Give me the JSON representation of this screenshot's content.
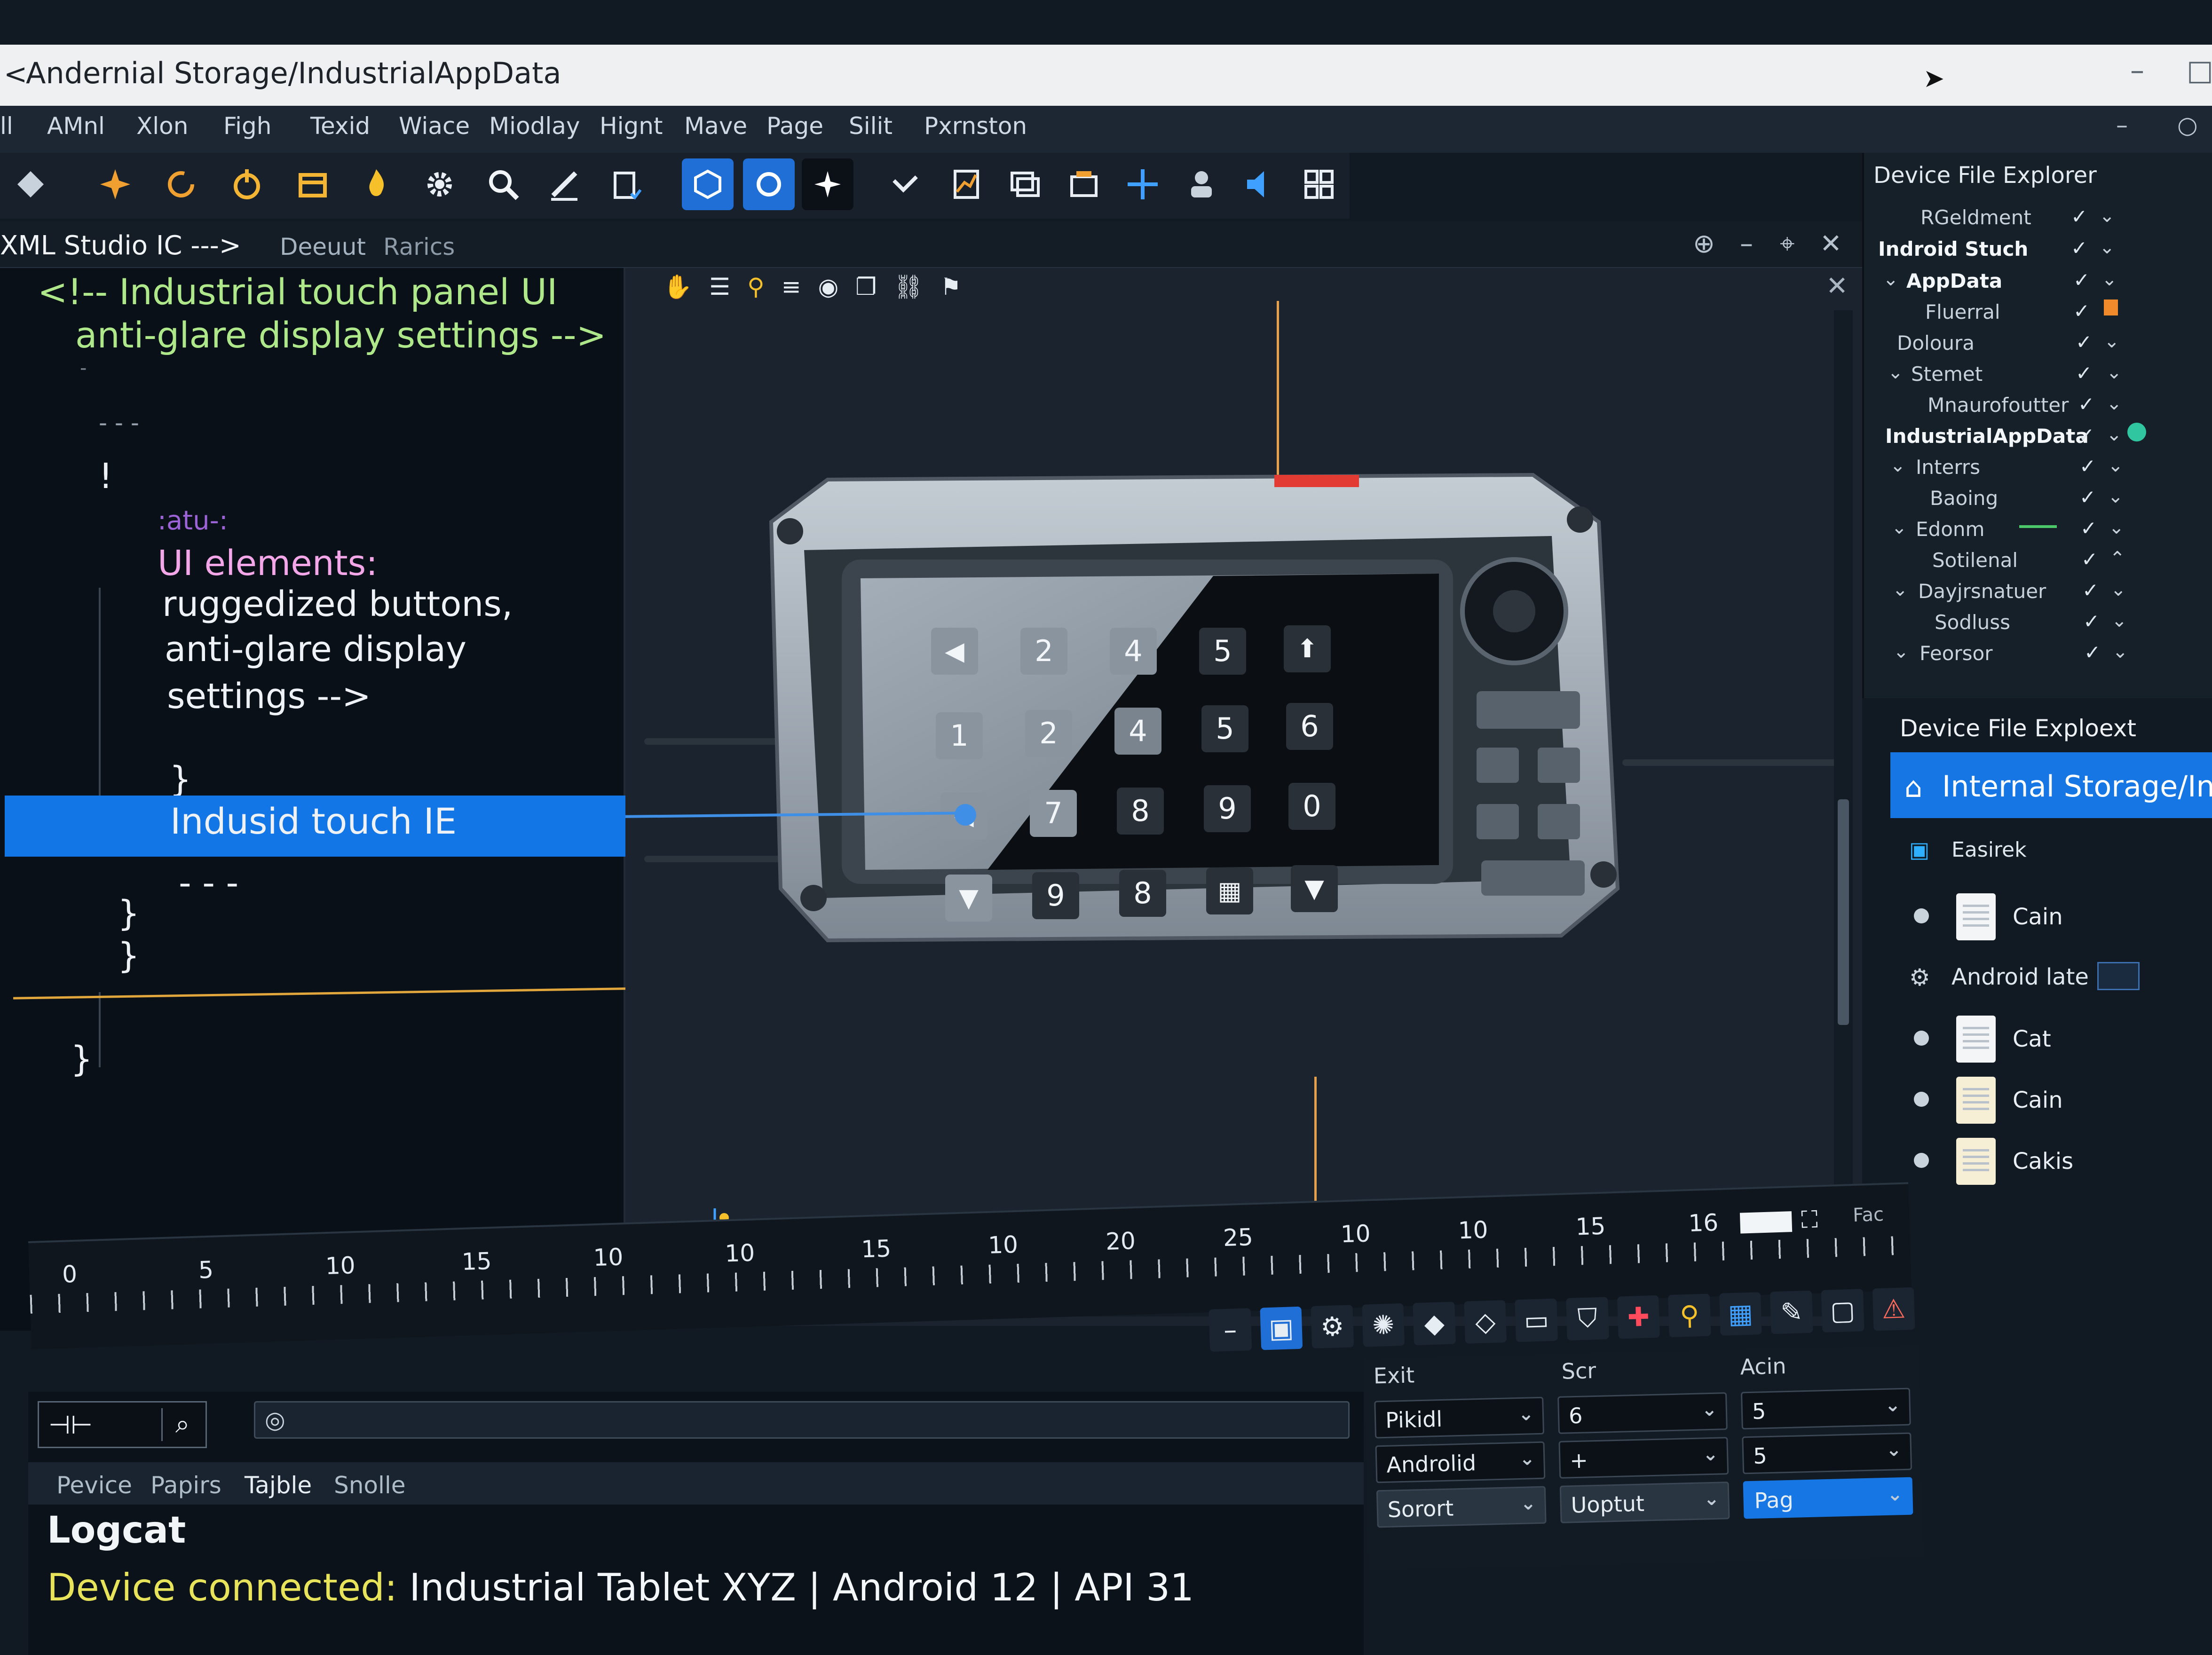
{
  "window": {
    "title": "Andernial  Storage/IndustrialAppData",
    "back_glyph": "<",
    "minimize_glyph": "–",
    "maximize_glyph": "□"
  },
  "menu": {
    "items": [
      "ll",
      "AMnl",
      "Xlon",
      "Figh",
      "Texid",
      "Wiace",
      "Miodlay",
      "Hignt",
      "Mave",
      "Page",
      "Silit",
      "Pxrnston"
    ],
    "right_controls": [
      "–",
      "○"
    ]
  },
  "toolbar": {
    "icons": [
      "diamond-icon",
      "star-icon",
      "refresh-icon",
      "power-icon",
      "package-icon",
      "flame-icon",
      "gear-icon",
      "search-icon",
      "pen-icon",
      "clipboard-icon",
      "cube-icon",
      "rotate-icon",
      "sparkle-icon",
      "checkmark-icon",
      "chart-icon",
      "layers-icon",
      "box-icon",
      "crosshair-icon",
      "user-icon",
      "speaker-icon",
      "grid-icon"
    ]
  },
  "editor_tabs": {
    "active": "XML Studio IC --->",
    "tab2": "Deeuut",
    "tab3": "Rarics",
    "controls": [
      "⊕",
      "–",
      "⌖",
      "✕"
    ]
  },
  "code": {
    "comment1": "<!-- Industrial touch panel UI",
    "comment2": "anti-glare display settings -->",
    "frag1": "-",
    "frag2": "- - -",
    "frag3": "!",
    "status": ":atu-:",
    "ui1": "UI elements:",
    "ui2": "ruggedized buttons,",
    "ui3": "anti-glare display",
    "ui4": "settings -->",
    "brace1": "}",
    "highlight": "Indusid touch IE",
    "dots": "- - -",
    "brace2": "}",
    "brace3": "}",
    "brace4": "}"
  },
  "keypad": {
    "row1": [
      "◀",
      "2",
      "4",
      "5",
      "⬆"
    ],
    "row2": [
      "1",
      "2",
      "4",
      "5",
      "6"
    ],
    "row3": [
      "◀",
      "7",
      "8",
      "9",
      "0"
    ],
    "row4": [
      "▼",
      "9",
      "8",
      "▦",
      "▼"
    ]
  },
  "explorer_tree": {
    "header": "Device  File  Explorer",
    "rows": [
      "RGeldment",
      "Indroid Stuch",
      "AppData",
      "Fluerral",
      "Doloura",
      "Stemet",
      "Mnaurofoutter",
      "IndustrialAppData",
      "Interrs",
      "Baoing",
      "Edonm",
      "Sotilenal",
      "Dayjrsnatuer",
      "Sodluss",
      "Feorsor"
    ]
  },
  "file_explorer": {
    "header": "Device File Exploext",
    "path": "Internal Storage/Indus",
    "subheader": "Easirek",
    "files": [
      "Cain",
      "Android  late",
      "Cat",
      "Cain",
      "Cakis"
    ]
  },
  "timeline": {
    "labels": [
      "0",
      "5",
      "10",
      "15",
      "10",
      "10",
      "15",
      "10",
      "20",
      "25",
      "10",
      "10",
      "15",
      "16"
    ],
    "end_label": "Fac"
  },
  "bottom": {
    "tabs": [
      "Pevice",
      "Papirs",
      "Tajble",
      "Snolle"
    ],
    "logcat_title": "Logcat",
    "device_label": "Device connected:",
    "device_value": "Industrial Tablet XYZ | Android 12 | API 31"
  },
  "properties": {
    "col1_header": "Exit",
    "col2_header": "Scr",
    "col3_header": "Acin",
    "col1": [
      "Pikidl",
      "Androlid",
      "Sorort"
    ],
    "col2": [
      "6",
      "+",
      "Uoptut"
    ],
    "col3": [
      "5",
      "5",
      "Pag"
    ]
  }
}
